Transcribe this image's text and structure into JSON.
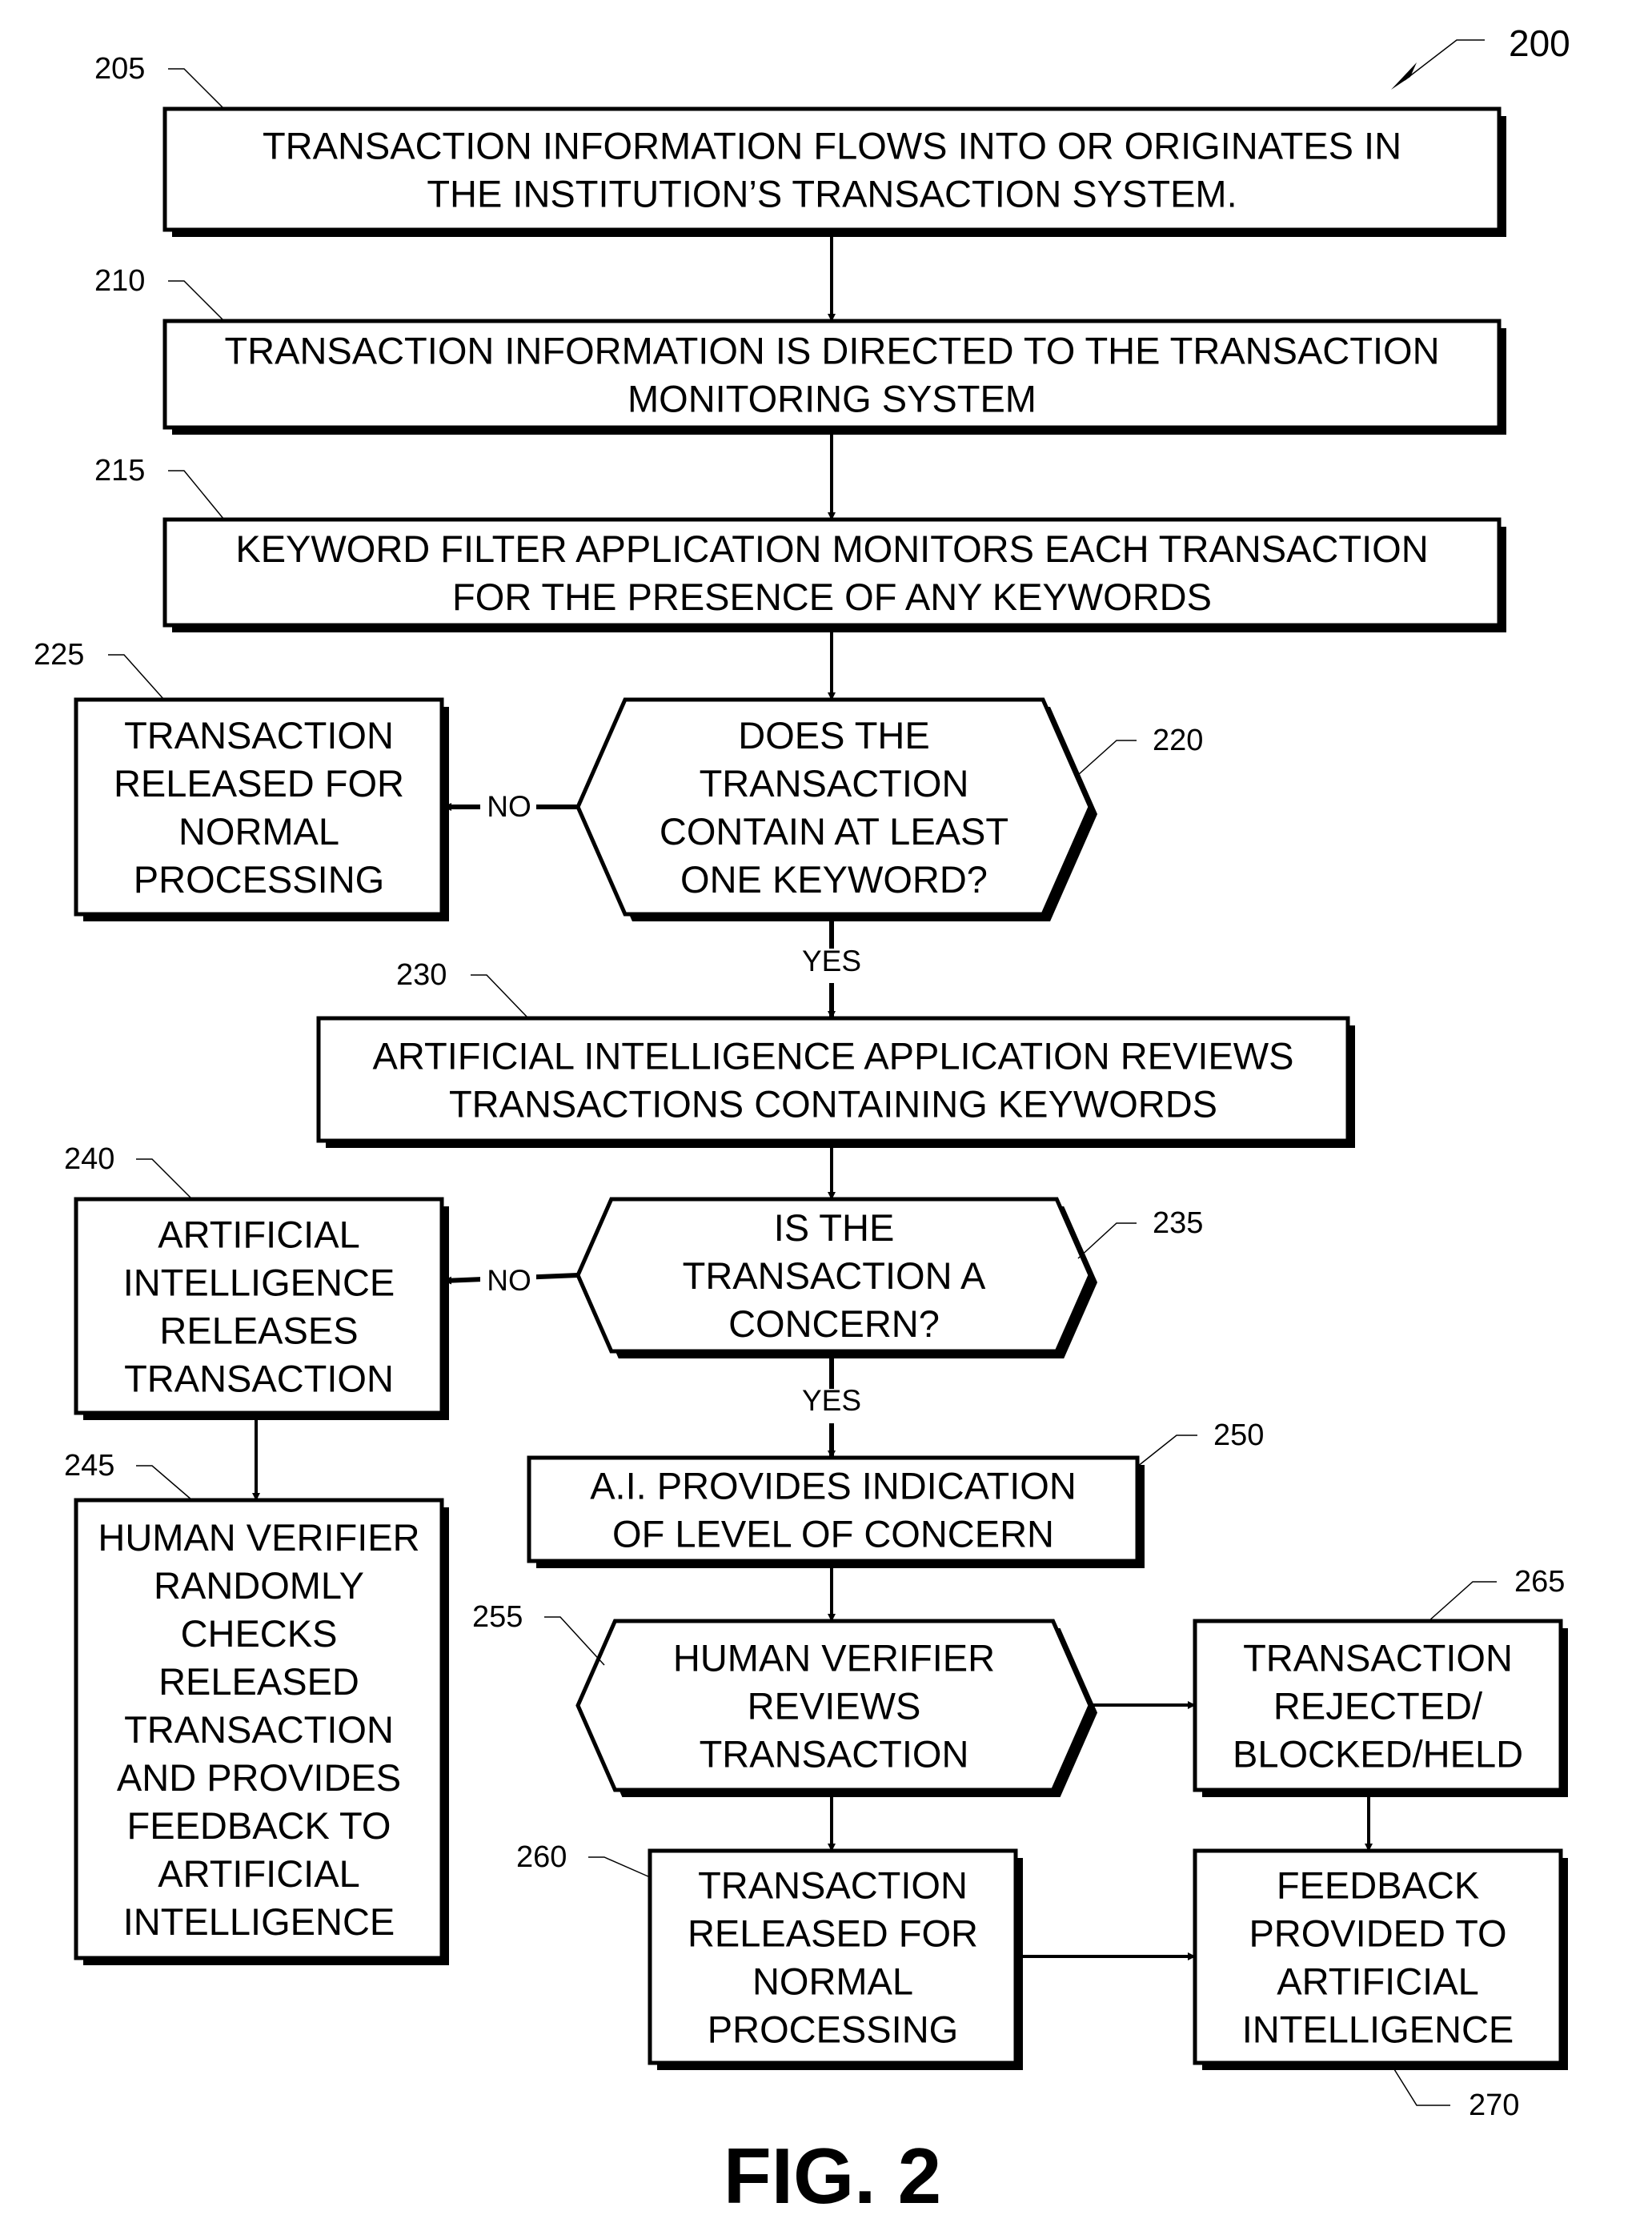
{
  "figure": {
    "ref": "200",
    "caption": "FIG. 2"
  },
  "nodes": [
    {
      "id": "n205",
      "ref": "205",
      "shape": "rect",
      "lines": [
        "TRANSACTION INFORMATION FLOWS INTO OR ORIGINATES IN",
        "THE INSTITUTION’S TRANSACTION SYSTEM."
      ]
    },
    {
      "id": "n210",
      "ref": "210",
      "shape": "rect",
      "lines": [
        "TRANSACTION INFORMATION IS DIRECTED TO THE TRANSACTION",
        "MONITORING SYSTEM"
      ]
    },
    {
      "id": "n215",
      "ref": "215",
      "shape": "rect",
      "lines": [
        "KEYWORD FILTER APPLICATION MONITORS EACH TRANSACTION",
        "FOR THE PRESENCE OF ANY KEYWORDS"
      ]
    },
    {
      "id": "n220",
      "ref": "220",
      "shape": "hexagon",
      "lines": [
        "DOES THE",
        "TRANSACTION",
        "CONTAIN AT LEAST",
        "ONE KEYWORD?"
      ]
    },
    {
      "id": "n225",
      "ref": "225",
      "shape": "rect",
      "lines": [
        "TRANSACTION",
        "RELEASED FOR",
        "NORMAL",
        "PROCESSING"
      ]
    },
    {
      "id": "n230",
      "ref": "230",
      "shape": "rect",
      "lines": [
        "ARTIFICIAL INTELLIGENCE APPLICATION REVIEWS",
        "TRANSACTIONS CONTAINING KEYWORDS"
      ]
    },
    {
      "id": "n235",
      "ref": "235",
      "shape": "hexagon",
      "lines": [
        "IS THE",
        "TRANSACTION A",
        "CONCERN?"
      ]
    },
    {
      "id": "n240",
      "ref": "240",
      "shape": "rect",
      "lines": [
        "ARTIFICIAL",
        "INTELLIGENCE",
        "RELEASES",
        "TRANSACTION"
      ]
    },
    {
      "id": "n245",
      "ref": "245",
      "shape": "rect",
      "lines": [
        "HUMAN VERIFIER",
        "RANDOMLY",
        "CHECKS",
        "RELEASED",
        "TRANSACTION",
        "AND PROVIDES",
        "FEEDBACK TO",
        "ARTIFICIAL",
        "INTELLIGENCE"
      ]
    },
    {
      "id": "n250",
      "ref": "250",
      "shape": "rect",
      "lines": [
        "A.I. PROVIDES INDICATION",
        "OF LEVEL OF CONCERN"
      ]
    },
    {
      "id": "n255",
      "ref": "255",
      "shape": "hexagon",
      "lines": [
        "HUMAN VERIFIER",
        "REVIEWS",
        "TRANSACTION"
      ]
    },
    {
      "id": "n260",
      "ref": "260",
      "shape": "rect",
      "lines": [
        "TRANSACTION",
        "RELEASED FOR",
        "NORMAL",
        "PROCESSING"
      ]
    },
    {
      "id": "n265",
      "ref": "265",
      "shape": "rect",
      "lines": [
        "TRANSACTION",
        "REJECTED/",
        "BLOCKED/HELD"
      ]
    },
    {
      "id": "n270",
      "ref": "270",
      "shape": "rect",
      "lines": [
        "FEEDBACK",
        "PROVIDED TO",
        "ARTIFICIAL",
        "INTELLIGENCE"
      ]
    }
  ],
  "edges": [
    {
      "from": "n205",
      "to": "n210",
      "label": ""
    },
    {
      "from": "n210",
      "to": "n215",
      "label": ""
    },
    {
      "from": "n215",
      "to": "n220",
      "label": ""
    },
    {
      "from": "n220",
      "to": "n225",
      "label": "NO"
    },
    {
      "from": "n220",
      "to": "n230",
      "label": "YES"
    },
    {
      "from": "n230",
      "to": "n235",
      "label": ""
    },
    {
      "from": "n235",
      "to": "n240",
      "label": "NO"
    },
    {
      "from": "n235",
      "to": "n250",
      "label": "YES"
    },
    {
      "from": "n240",
      "to": "n245",
      "label": ""
    },
    {
      "from": "n250",
      "to": "n255",
      "label": ""
    },
    {
      "from": "n255",
      "to": "n265",
      "label": ""
    },
    {
      "from": "n255",
      "to": "n260",
      "label": ""
    },
    {
      "from": "n265",
      "to": "n270",
      "label": ""
    },
    {
      "from": "n260",
      "to": "n270",
      "label": ""
    }
  ]
}
